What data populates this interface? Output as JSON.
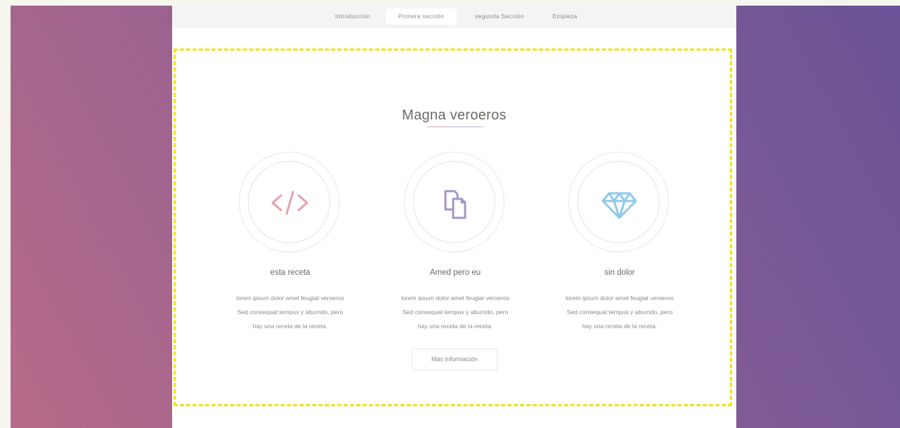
{
  "nav": {
    "items": [
      {
        "label": "Introducción"
      },
      {
        "label": "Primera sección"
      },
      {
        "label": "segunda Sección"
      },
      {
        "label": "Empieza"
      }
    ],
    "active_index": 1
  },
  "section": {
    "title": "Magna veroeros",
    "features": [
      {
        "icon": "code-icon",
        "icon_color": "#e4a1a8",
        "title": "esta receta",
        "text": "lorem ipsum dolor amet feugiat veroeros\nSed consequat tempus y aburrido, pero\nhay una receta de la receta."
      },
      {
        "icon": "copy-icon",
        "icon_color": "#a695c6",
        "title": "Amed pero eu",
        "text": "lorem ipsum dolor amet feugiat veroeros\nSed consequat tempus y aburrido, pero\nhay una receta de la receta."
      },
      {
        "icon": "diamond-icon",
        "icon_color": "#8ec9ea",
        "title": "sin dolor",
        "text": "lorem ipsum dolor amet feugiat veroeros\nSed consequat tempus y aburrido, pero\nhay una receta de la receta."
      }
    ],
    "button_label": "Más información"
  },
  "colors": {
    "highlight_dash": "#f3e20d",
    "gradient_start": "#b76b88",
    "gradient_end": "#6a5397"
  }
}
